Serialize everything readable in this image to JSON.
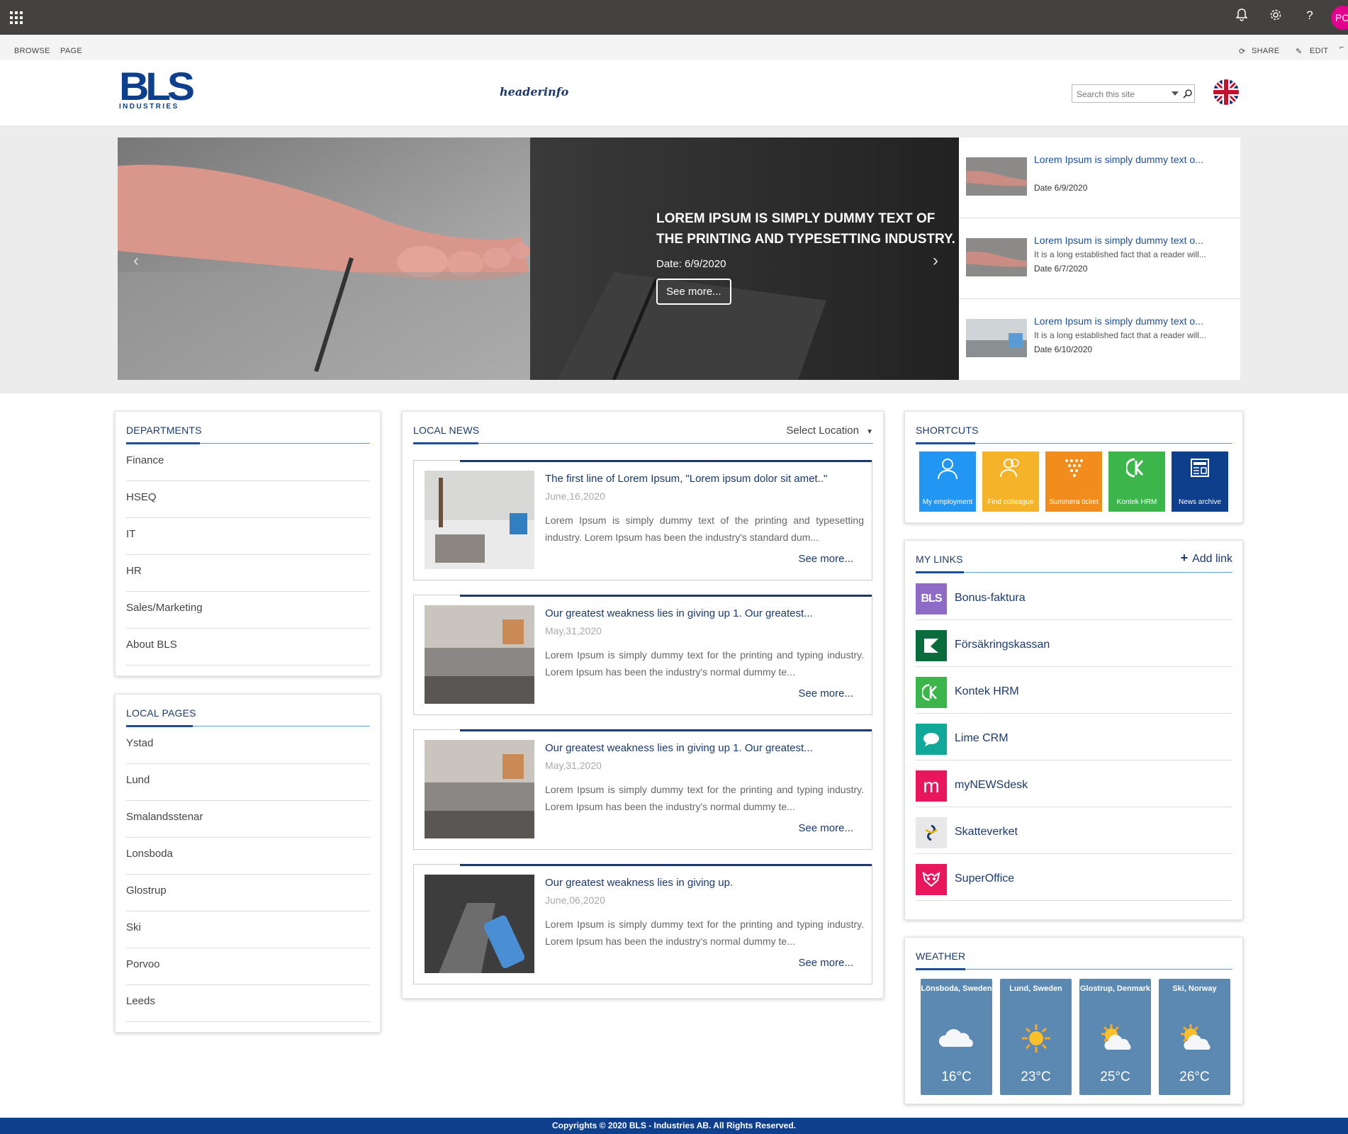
{
  "suitebar": {
    "avatar_initials": "PC"
  },
  "ribbon": {
    "browse": "BROWSE",
    "page": "PAGE",
    "share": "SHARE",
    "edit": "EDIT"
  },
  "header": {
    "logo_text": "BLS",
    "logo_sub": "INDUSTRIES",
    "headerinfo": "headerinfo",
    "search_placeholder": "Search this site"
  },
  "hero": {
    "title": "LOREM IPSUM IS SIMPLY DUMMY TEXT OF THE PRINTING AND TYPESETTING INDUSTRY.",
    "date": "Date: 6/9/2020",
    "button": "See more..."
  },
  "side_news": [
    {
      "title": "Lorem Ipsum is simply dummy text o...",
      "desc": "",
      "date": "Date 6/9/2020"
    },
    {
      "title": "Lorem Ipsum is simply dummy text o...",
      "desc": "It is a long established fact that a reader will...",
      "date": "Date 6/7/2020"
    },
    {
      "title": "Lorem Ipsum is simply dummy text o...",
      "desc": "It is a long established fact that a reader will...",
      "date": "Date 6/10/2020"
    }
  ],
  "departments": {
    "title": "DEPARTMENTS",
    "items": [
      "Finance",
      "HSEQ",
      "IT",
      "HR",
      "Sales/Marketing",
      "About BLS"
    ]
  },
  "local_pages": {
    "title": "LOCAL PAGES",
    "items": [
      "Ystad",
      "Lund",
      "Smalandsstenar",
      "Lonsboda",
      "Glostrup",
      "Ski",
      "Porvoo",
      "Leeds"
    ]
  },
  "local_news": {
    "title": "LOCAL NEWS",
    "select_location": "Select Location",
    "items": [
      {
        "title": "The first line of Lorem Ipsum, \"Lorem ipsum dolor sit amet..\"",
        "date": "June,16,2020",
        "text": "Lorem Ipsum is simply dummy text of the printing and typesetting industry. Lorem Ipsum has been the industry's standard dum...",
        "more": "See more..."
      },
      {
        "title": "Our greatest weakness lies in giving up 1. Our greatest...",
        "date": "May,31,2020",
        "text": "Lorem Ipsum is simply dummy text for the printing and typing industry. Lorem Ipsum has been the industry's normal dummy te...",
        "more": "See more..."
      },
      {
        "title": "Our greatest weakness lies in giving up 1. Our greatest...",
        "date": "May,31,2020",
        "text": "Lorem Ipsum is simply dummy text for the printing and typing industry. Lorem Ipsum has been the industry's normal dummy te...",
        "more": "See more..."
      },
      {
        "title": "Our greatest weakness lies in giving up.",
        "date": "June,06,2020",
        "text": "Lorem Ipsum is simply dummy text for the printing and typing industry. Lorem Ipsum has been the industry's normal dummy te...",
        "more": "See more..."
      }
    ]
  },
  "shortcuts": {
    "title": "SHORTCUTS",
    "items": [
      {
        "label": "My employment",
        "color": "#2196f3",
        "icon": "person-icon"
      },
      {
        "label": "Find colleague",
        "color": "#f5b32a",
        "icon": "people-icon"
      },
      {
        "label": "Summera ticket",
        "color": "#f28c1c",
        "icon": "dots-icon"
      },
      {
        "label": "Kontek HRM",
        "color": "#3cb54a",
        "icon": "kontek-icon"
      },
      {
        "label": "News archive",
        "color": "#0e3f8c",
        "icon": "news-icon"
      }
    ]
  },
  "my_links": {
    "title": "MY LINKS",
    "add_link": "Add link",
    "items": [
      {
        "label": "Bonus-faktura",
        "color": "#8e6cc6",
        "icon": "bls-bonus-icon",
        "glyph": "BLS"
      },
      {
        "label": "Försäkringskassan",
        "color": "#0a6b3c",
        "icon": "fk-icon",
        "glyph": "K"
      },
      {
        "label": "Kontek HRM",
        "color": "#3cb54a",
        "icon": "kontek-icon",
        "glyph": "(K"
      },
      {
        "label": "Lime CRM",
        "color": "#11a89a",
        "icon": "lime-icon",
        "glyph": "crm"
      },
      {
        "label": "myNEWSdesk",
        "color": "#e8175d",
        "icon": "mynewsdesk-icon",
        "glyph": "m"
      },
      {
        "label": "Skatteverket",
        "color": "#e8e8e8",
        "icon": "skatteverket-icon",
        "glyph": "S"
      },
      {
        "label": "SuperOffice",
        "color": "#e8175d",
        "icon": "superoffice-icon",
        "glyph": "SO"
      }
    ]
  },
  "weather": {
    "title": "WEATHER",
    "items": [
      {
        "location": "Lönsboda, Sweden",
        "temp": "16°C",
        "icon": "cloud-icon"
      },
      {
        "location": "Lund, Sweden",
        "temp": "23°C",
        "icon": "sun-icon"
      },
      {
        "location": "Glostrup, Denmark",
        "temp": "25°C",
        "icon": "sun-cloud-icon"
      },
      {
        "location": "Ski, Norway",
        "temp": "26°C",
        "icon": "sun-cloud-icon"
      }
    ]
  },
  "footer": {
    "text": "Copyrights © 2020 BLS - Industries AB. All Rights Reserved."
  }
}
